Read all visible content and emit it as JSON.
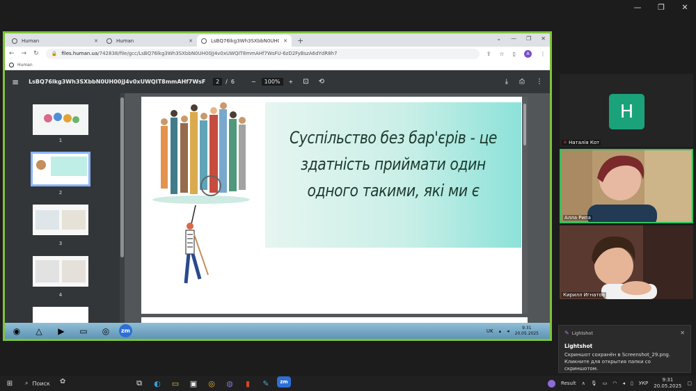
{
  "browser": {
    "tabs": [
      {
        "label": "Human"
      },
      {
        "label": "Human"
      },
      {
        "label": "LsBQ76lkg3Wh3SXbbN0UH0(iJ4v…"
      }
    ],
    "url_host": "files.human.ua",
    "url_path": "/742838/file/gcc/LsBQ76lkg3Wh3SXbbN0UH00jJ4v0xUWQIT8mmAHf7WsFU-6zD2FyBszA6dYdR8h7",
    "bookmark_label": "Human",
    "avatar_letter": "A"
  },
  "pdf": {
    "filename": "LsBQ76lkg3Wh3SXbbN0UH00jJ4v0xUWQIT8mmAHf7WsFU-6zD2FyB…",
    "current_page": "2",
    "page_sep": "/",
    "total_pages": "6",
    "zoom": "100%",
    "thumb_numbers": [
      "1",
      "2",
      "3",
      "4"
    ],
    "slide_text": "Суспільство без бар'єрів - це здатність приймати один одного такими, які ми є"
  },
  "inner_taskbar": {
    "lang": "UK",
    "time": "9:31",
    "date": "20.05.2025",
    "zoom_label": "zm"
  },
  "participants": {
    "p1_initial": "H",
    "p1_name": "Наталія Кот",
    "p2_name": "Алла Рипа",
    "p3_name": "Кирилл Игнатов"
  },
  "notification": {
    "app": "Lightshot",
    "title": "Lightshot",
    "message": "Скриншот сохранён в Screenshot_29.png. Кликните для открытия папки со скриншотом."
  },
  "taskbar": {
    "search_label": "Поиск",
    "result_label": "Result",
    "lang": "УКР",
    "time": "9:31",
    "date": "20.05.2025",
    "zoom_label": "zm"
  }
}
